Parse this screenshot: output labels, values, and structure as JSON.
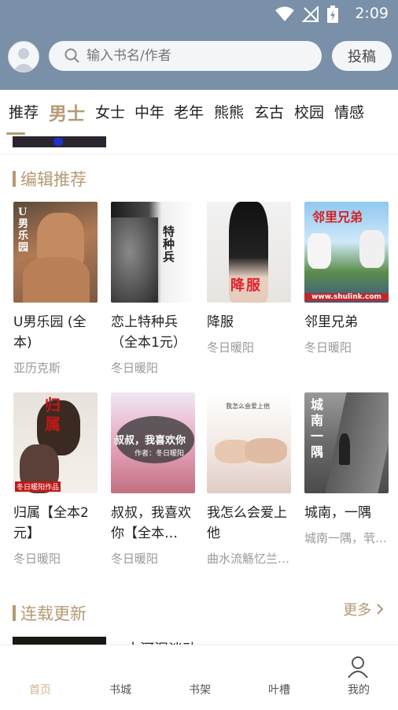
{
  "status": {
    "time": "2:09"
  },
  "search": {
    "placeholder": "输入书名/作者"
  },
  "header": {
    "submit_label": "投稿"
  },
  "tabs": [
    {
      "label": "推荐"
    },
    {
      "label": "男士"
    },
    {
      "label": "女士"
    },
    {
      "label": "中年"
    },
    {
      "label": "老年"
    },
    {
      "label": "熊熊"
    },
    {
      "label": "玄古"
    },
    {
      "label": "校园"
    },
    {
      "label": "情感"
    }
  ],
  "sections": {
    "editor": {
      "title": "编辑推荐"
    },
    "serial": {
      "title": "连载更新",
      "more": "更多"
    }
  },
  "books": [
    {
      "title": "U男乐园 (全本)",
      "author": "亚历克斯",
      "cover_text": "U男乐园"
    },
    {
      "title": "恋上特种兵（全本1元）",
      "author": "冬日暖阳",
      "cover_text": "特种兵"
    },
    {
      "title": "降服",
      "author": "冬日暖阳",
      "cover_text": "降服"
    },
    {
      "title": "邻里兄弟",
      "author": "冬日暖阳",
      "cover_text": "邻里兄弟",
      "cover_sub": "www.shulink.com"
    },
    {
      "title": "归属【全本2元】",
      "author": "冬日暖阳",
      "cover_text": "归属",
      "cover_sub": "冬日暖阳作品"
    },
    {
      "title": "叔叔，我喜欢你【全本…",
      "author": "冬日暖阳",
      "cover_text": "叔叔，我喜欢你",
      "cover_sub": "作者：冬日暖阳"
    },
    {
      "title": "我怎么会爱上他",
      "author": "曲水流觞忆兰…",
      "cover_text": "我怎么会爱上他"
    },
    {
      "title": "城南，一隅",
      "author": "城南一隅，茕…",
      "cover_text": "城南一隅"
    }
  ],
  "serial_first": {
    "title": "十河涅淡动"
  },
  "nav": [
    {
      "label": "首页"
    },
    {
      "label": "书城"
    },
    {
      "label": "书架"
    },
    {
      "label": "叶槽"
    },
    {
      "label": "我的"
    }
  ],
  "colors": {
    "header_bg": "#7a8fa8",
    "accent": "#b49a74",
    "nav_active": "#d4b48a"
  },
  "icons": [
    "wifi-icon",
    "no-signal-icon",
    "battery-icon",
    "avatar-icon",
    "search-icon",
    "chevron-right-icon",
    "user-icon"
  ]
}
